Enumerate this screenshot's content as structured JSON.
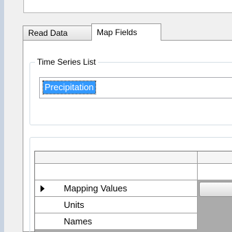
{
  "tabs": [
    {
      "label": "Read Data",
      "selected": false
    },
    {
      "label": "Map Fields",
      "selected": true
    }
  ],
  "time_series_group": {
    "legend": "Time Series List",
    "items": [
      "Precipitation"
    ],
    "selected_item": "Precipitation"
  },
  "mapping_grid": {
    "rows": [
      {
        "label": "Mapping Values",
        "current": true
      },
      {
        "label": "Units",
        "current": false
      },
      {
        "label": "Names",
        "current": false
      }
    ]
  },
  "colors": {
    "selection": "#3399ff",
    "window_bg": "#f0f0f0",
    "grid_bg": "#ababab"
  }
}
